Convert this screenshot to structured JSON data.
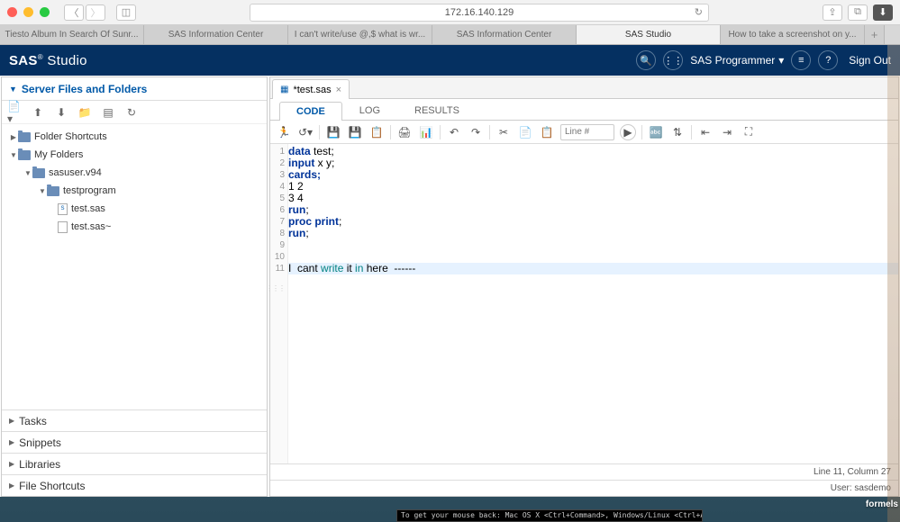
{
  "browser": {
    "url": "172.16.140.129",
    "tabs": [
      "Tiesto Album In Search Of Sunr...",
      "SAS Information Center",
      "I can't write/use @,$ what is wr...",
      "SAS Information Center",
      "SAS Studio",
      "How to take a screenshot on y..."
    ],
    "active_tab": 4
  },
  "header": {
    "brand_pre": "SAS",
    "brand_post": " Studio",
    "user_label": "SAS Programmer",
    "signout": "Sign Out"
  },
  "sidebar": {
    "title": "Server Files and Folders",
    "tree": {
      "root": "Folder Shortcuts",
      "myfolders": "My Folders",
      "sasuser": "sasuser.v94",
      "testprogram": "testprogram",
      "file1": "test.sas",
      "file2": "test.sas~"
    },
    "panels": [
      "Tasks",
      "Snippets",
      "Libraries",
      "File Shortcuts"
    ]
  },
  "editor": {
    "tab_name": "*test.sas",
    "view_tabs": {
      "code": "CODE",
      "log": "LOG",
      "results": "RESULTS"
    },
    "line_placeholder": "Line #",
    "code": {
      "l1": "data",
      "l1b": " test;",
      "l2": "input",
      "l2b": " x y;",
      "l3": "cards;",
      "l4": "1 2",
      "l5": "3 4",
      "l6": "run",
      "l6b": ";",
      "l7": "proc print",
      "l7b": ";",
      "l8": "run",
      "l8b": ";",
      "l9": "",
      "l10": "",
      "l11a": "I",
      "l11b": "  cant ",
      "l11c": "write",
      "l11d": " it ",
      "l11e": "in",
      "l11f": " here  ------"
    },
    "status": "Line 11, Column 27",
    "user_status": "User: sasdemo"
  },
  "console": "To get your mouse back: Mac OS X <Ctrl+Command>, Windows/Linux <Ctrl+Alt>",
  "desktop_label": "formels"
}
